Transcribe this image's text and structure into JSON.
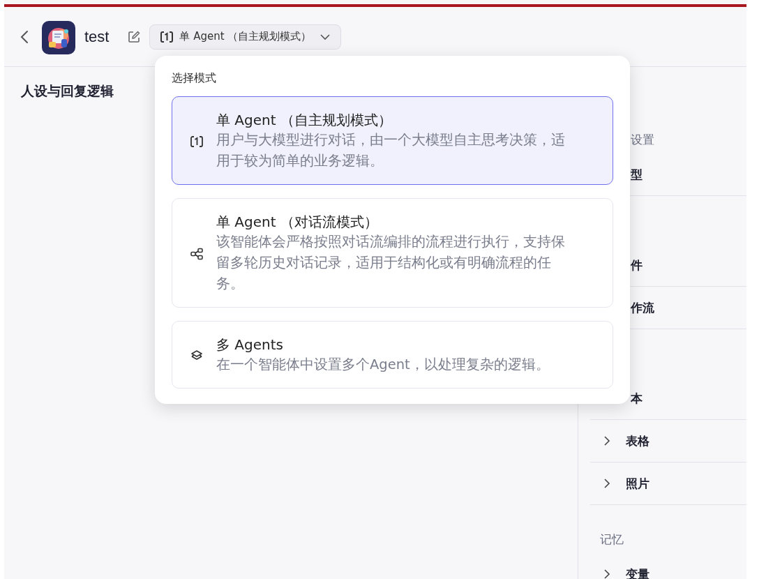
{
  "header": {
    "app_name": "test",
    "mode_button": {
      "label": "单 Agent （自主规划模式）",
      "kind": "single"
    }
  },
  "left_panel": {
    "title": "人设与回复逻辑"
  },
  "sidebar": [
    {
      "kind": "label",
      "text": "设置"
    },
    {
      "kind": "item",
      "text": "型"
    },
    {
      "kind": "item",
      "text": "件"
    },
    {
      "kind": "item",
      "text": "作流"
    },
    {
      "kind": "item",
      "text": "本"
    },
    {
      "kind": "group",
      "text": "表格"
    },
    {
      "kind": "group",
      "text": "照片"
    },
    {
      "kind": "label",
      "text": "记忆"
    },
    {
      "kind": "group",
      "text": "变量"
    }
  ],
  "mode_popover": {
    "title": "选择模式",
    "options": [
      {
        "kind": "single",
        "title": "单 Agent （自主规划模式）",
        "description": "用户与大模型进行对话，由一个大模型自主思考决策，适用于较为简单的业务逻辑。",
        "selected": true
      },
      {
        "kind": "flow",
        "title": "单 Agent （对话流模式）",
        "description": "该智能体会严格按照对话流编排的流程进行执行，支持保留多轮历史对话记录，适用于结构化或有明确流程的任务。",
        "selected": false
      },
      {
        "kind": "multi",
        "title": "多 Agents",
        "description": "在一个智能体中设置多个Agent，以处理复杂的逻辑。",
        "selected": false
      }
    ]
  }
}
